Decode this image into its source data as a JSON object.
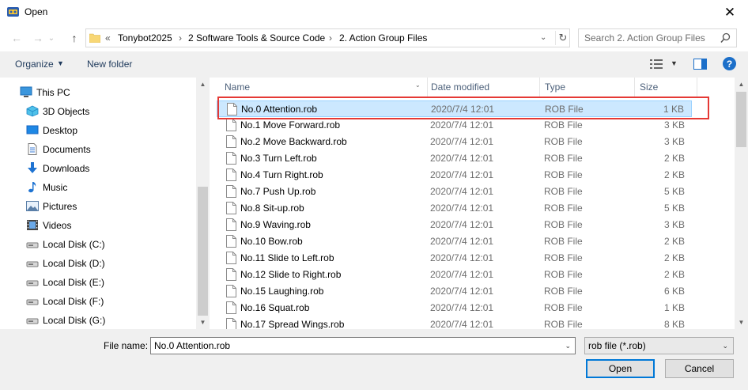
{
  "window": {
    "title": "Open",
    "close_glyph": "✕"
  },
  "nav": {
    "back_glyph": "←",
    "forward_glyph": "→",
    "recent_glyph": "⌄",
    "up_glyph": "↑"
  },
  "address": {
    "overflow": "«",
    "crumbs": [
      "Tonybot2025",
      "2 Software Tools & Source Code",
      "2. Action Group Files"
    ],
    "separator": "›",
    "dropdown_glyph": "⌄",
    "refresh_glyph": "↻"
  },
  "search": {
    "placeholder": "Search 2. Action Group Files"
  },
  "toolbar": {
    "organize_label": "Organize",
    "caret": "▼",
    "new_folder_label": "New folder",
    "help_label": "?"
  },
  "sidebar": {
    "items": [
      {
        "label": "This PC",
        "icon": "computer-icon"
      },
      {
        "label": "3D Objects",
        "icon": "cube-icon"
      },
      {
        "label": "Desktop",
        "icon": "desktop-icon"
      },
      {
        "label": "Documents",
        "icon": "documents-icon"
      },
      {
        "label": "Downloads",
        "icon": "download-icon"
      },
      {
        "label": "Music",
        "icon": "music-icon"
      },
      {
        "label": "Pictures",
        "icon": "pictures-icon"
      },
      {
        "label": "Videos",
        "icon": "videos-icon"
      },
      {
        "label": "Local Disk (C:)",
        "icon": "disk-icon"
      },
      {
        "label": "Local Disk (D:)",
        "icon": "disk-icon"
      },
      {
        "label": "Local Disk (E:)",
        "icon": "disk-icon"
      },
      {
        "label": "Local Disk (F:)",
        "icon": "disk-icon"
      },
      {
        "label": "Local Disk (G:)",
        "icon": "disk-icon"
      }
    ]
  },
  "columns": {
    "name": "Name",
    "date": "Date modified",
    "type": "Type",
    "size": "Size"
  },
  "files": [
    {
      "name": "No.0 Attention.rob",
      "date": "2020/7/4 12:01",
      "type": "ROB File",
      "size": "1 KB",
      "selected": true
    },
    {
      "name": "No.1 Move Forward.rob",
      "date": "2020/7/4 12:01",
      "type": "ROB File",
      "size": "3 KB"
    },
    {
      "name": "No.2 Move Backward.rob",
      "date": "2020/7/4 12:01",
      "type": "ROB File",
      "size": "3 KB"
    },
    {
      "name": "No.3 Turn Left.rob",
      "date": "2020/7/4 12:01",
      "type": "ROB File",
      "size": "2 KB"
    },
    {
      "name": "No.4 Turn Right.rob",
      "date": "2020/7/4 12:01",
      "type": "ROB File",
      "size": "2 KB"
    },
    {
      "name": "No.7 Push Up.rob",
      "date": "2020/7/4 12:01",
      "type": "ROB File",
      "size": "5 KB"
    },
    {
      "name": "No.8 Sit-up.rob",
      "date": "2020/7/4 12:01",
      "type": "ROB File",
      "size": "5 KB"
    },
    {
      "name": "No.9 Waving.rob",
      "date": "2020/7/4 12:01",
      "type": "ROB File",
      "size": "3 KB"
    },
    {
      "name": "No.10 Bow.rob",
      "date": "2020/7/4 12:01",
      "type": "ROB File",
      "size": "2 KB"
    },
    {
      "name": "No.11 Slide to Left.rob",
      "date": "2020/7/4 12:01",
      "type": "ROB File",
      "size": "2 KB"
    },
    {
      "name": "No.12 Slide to Right.rob",
      "date": "2020/7/4 12:01",
      "type": "ROB File",
      "size": "2 KB"
    },
    {
      "name": "No.15 Laughing.rob",
      "date": "2020/7/4 12:01",
      "type": "ROB File",
      "size": "6 KB"
    },
    {
      "name": "No.16 Squat.rob",
      "date": "2020/7/4 12:01",
      "type": "ROB File",
      "size": "1 KB"
    },
    {
      "name": "No.17 Spread Wings.rob",
      "date": "2020/7/4 12:01",
      "type": "ROB File",
      "size": "8 KB"
    }
  ],
  "bottom": {
    "file_name_label": "File name:",
    "file_name_value": "No.0 Attention.rob",
    "filter_value": "rob file (*.rob)",
    "dropdown_glyph": "⌄",
    "open_label": "Open",
    "cancel_label": "Cancel"
  },
  "colors": {
    "accent": "#0078d7",
    "selection": "#cce8ff",
    "highlight_box": "#e53935",
    "link": "#1e395b"
  }
}
